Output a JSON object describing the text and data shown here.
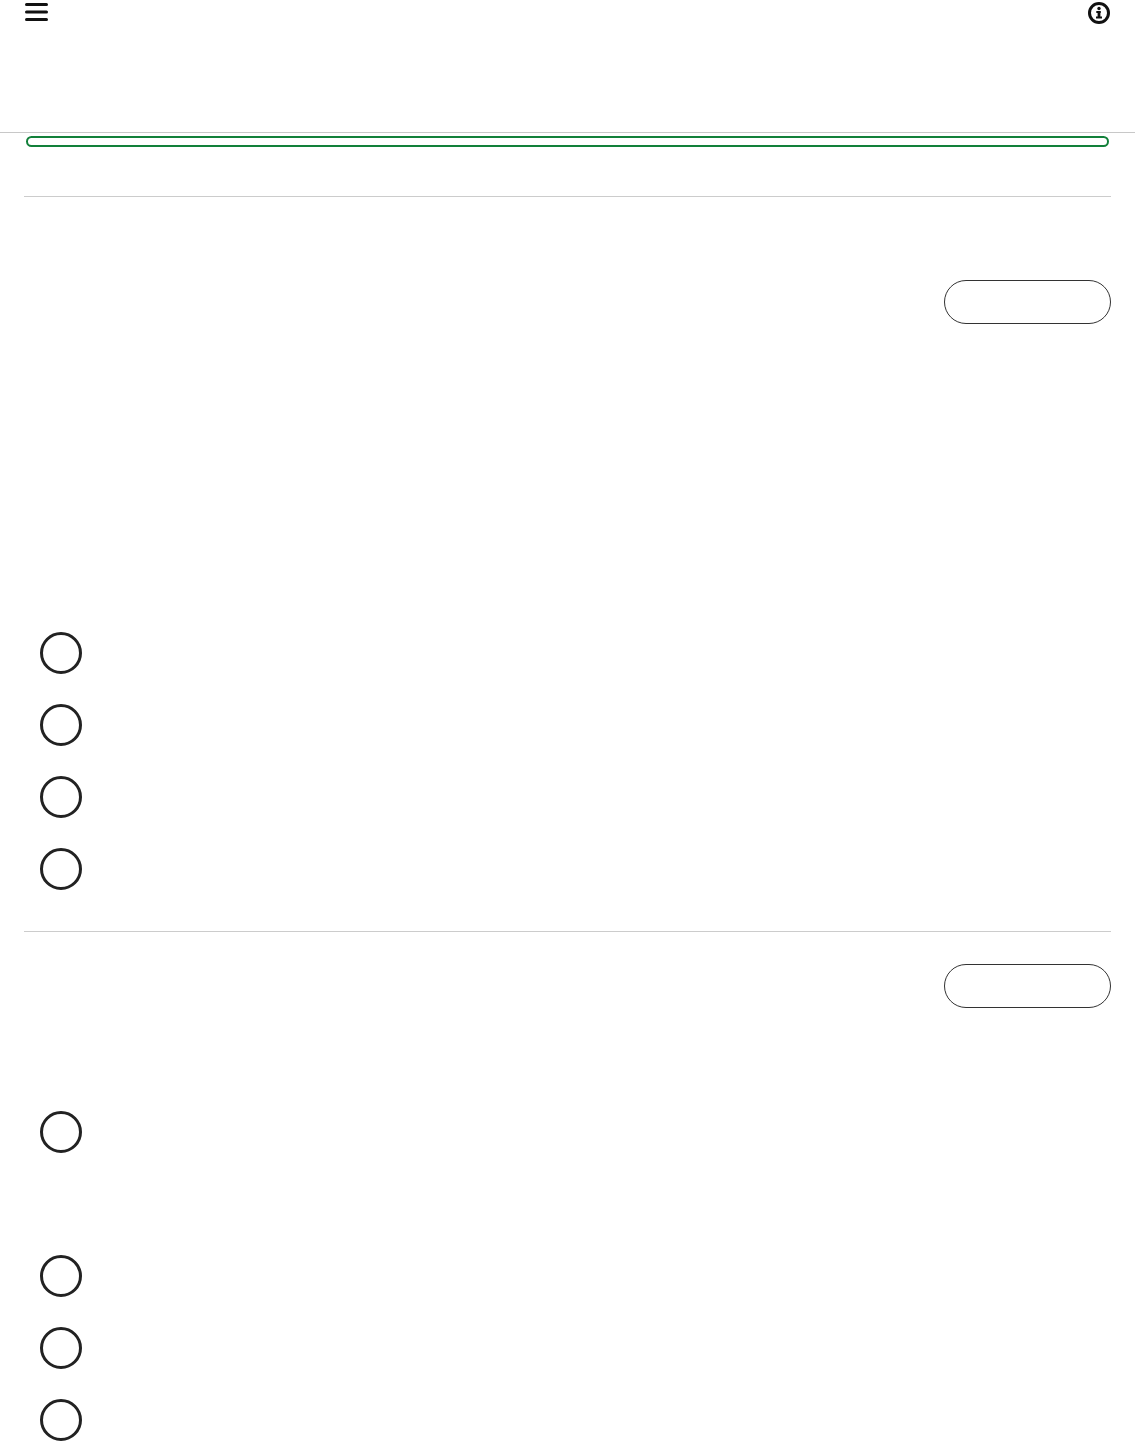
{
  "progress": {
    "level": 0
  },
  "questions": [
    {
      "options": [
        {
          "selected": false
        },
        {
          "selected": false
        },
        {
          "selected": false
        },
        {
          "selected": false
        }
      ]
    },
    {
      "options": [
        {
          "selected": false
        },
        {
          "selected": false
        },
        {
          "selected": false
        },
        {
          "selected": false
        }
      ]
    }
  ]
}
